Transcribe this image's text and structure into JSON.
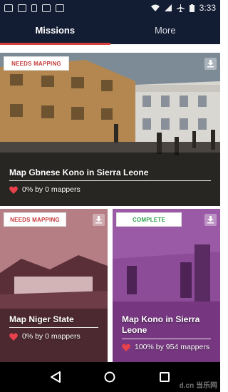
{
  "status_bar": {
    "time": "3:33",
    "left_icons": [
      "app-icon",
      "image-icon",
      "sim-icon",
      "bag-icon",
      "camera-icon"
    ],
    "right_icons": [
      "wifi-icon",
      "signal-icon",
      "airplane-icon",
      "battery-icon"
    ]
  },
  "tabs": {
    "missions": "Missions",
    "more": "More",
    "active": "missions",
    "indicator_color": "#d73f3f",
    "bar_color": "#121c33"
  },
  "cards": [
    {
      "status": "NEEDS MAPPING",
      "status_color": "#c43a3a",
      "title": "Map Gbnese Kono in Sierra Leone",
      "stat": "0% by 0 mappers",
      "progress_percent": 0
    },
    {
      "status": "NEEDS MAPPING",
      "status_color": "#c43a3a",
      "title": "Map Niger State",
      "stat": "0% by 0 mappers",
      "progress_percent": 0
    },
    {
      "status": "COMPLETE",
      "status_color": "#2f9e4e",
      "title": "Map Kono in Sierra Leone",
      "stat": "100% by 954 mappers",
      "progress_percent": 100
    }
  ],
  "nav": {
    "icons": [
      "back-icon",
      "home-icon",
      "recents-icon"
    ]
  },
  "watermark": "d.cn 当乐网"
}
